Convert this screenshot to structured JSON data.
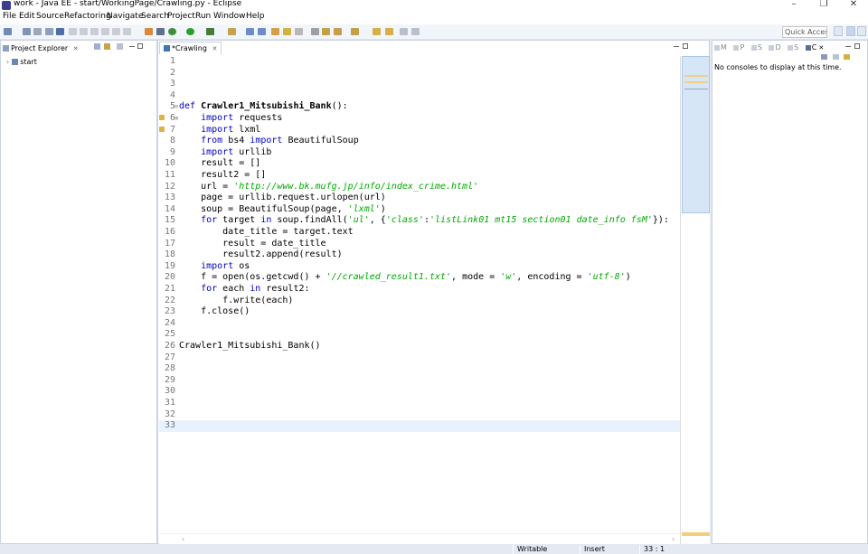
{
  "window": {
    "title": "work - Java EE - start/WorkingPage/Crawling.py - Eclipse",
    "minimize": "–",
    "restore": "❐",
    "close": "✕"
  },
  "menu": [
    "File",
    "Edit",
    "Source",
    "Refactoring",
    "Navigate",
    "Search",
    "Project",
    "Run",
    "Window",
    "Help"
  ],
  "toolbar": {
    "quick_access_placeholder": "Quick Access"
  },
  "project_explorer": {
    "title": "Project Explorer",
    "close": "✕",
    "tree": [
      {
        "label": "start",
        "expander": "›"
      }
    ]
  },
  "editor": {
    "tab_label": "*Crawling",
    "tab_close": "✕",
    "current_line": 33,
    "lines": [
      {
        "n": 1,
        "segs": []
      },
      {
        "n": 2,
        "segs": []
      },
      {
        "n": 3,
        "segs": []
      },
      {
        "n": 4,
        "segs": []
      },
      {
        "n": 5,
        "fold": "⊖",
        "segs": [
          {
            "t": "kw",
            "v": "def "
          },
          {
            "t": "fn",
            "v": "Crawler1_Mitsubishi_Bank"
          },
          {
            "t": "",
            "v": "():"
          }
        ]
      },
      {
        "n": 6,
        "fold": "⊕",
        "warn": true,
        "segs": [
          {
            "t": "",
            "v": "    "
          },
          {
            "t": "kw",
            "v": "import"
          },
          {
            "t": "",
            "v": " requests"
          }
        ]
      },
      {
        "n": 7,
        "warn": true,
        "segs": [
          {
            "t": "",
            "v": "    "
          },
          {
            "t": "kw",
            "v": "import"
          },
          {
            "t": "",
            "v": " lxml"
          }
        ]
      },
      {
        "n": 8,
        "segs": [
          {
            "t": "",
            "v": "    "
          },
          {
            "t": "kw",
            "v": "from"
          },
          {
            "t": "",
            "v": " bs4 "
          },
          {
            "t": "kw",
            "v": "import"
          },
          {
            "t": "",
            "v": " BeautifulSoup"
          }
        ]
      },
      {
        "n": 9,
        "segs": [
          {
            "t": "",
            "v": "    "
          },
          {
            "t": "kw",
            "v": "import"
          },
          {
            "t": "",
            "v": " urllib"
          }
        ]
      },
      {
        "n": 10,
        "segs": [
          {
            "t": "",
            "v": "    result = []"
          }
        ]
      },
      {
        "n": 11,
        "segs": [
          {
            "t": "",
            "v": "    result2 = []"
          }
        ]
      },
      {
        "n": 12,
        "segs": [
          {
            "t": "",
            "v": "    url = "
          },
          {
            "t": "str",
            "v": "'http://www.bk.mufg.jp/info/index_crime.html'"
          }
        ]
      },
      {
        "n": 13,
        "segs": [
          {
            "t": "",
            "v": "    page = urllib.request.urlopen(url)"
          }
        ]
      },
      {
        "n": 14,
        "segs": [
          {
            "t": "",
            "v": "    soup = BeautifulSoup(page, "
          },
          {
            "t": "str",
            "v": "'lxml'"
          },
          {
            "t": "",
            "v": ")"
          }
        ]
      },
      {
        "n": 15,
        "segs": [
          {
            "t": "",
            "v": "    "
          },
          {
            "t": "kw",
            "v": "for"
          },
          {
            "t": "",
            "v": " target "
          },
          {
            "t": "kw",
            "v": "in"
          },
          {
            "t": "",
            "v": " soup.findAll("
          },
          {
            "t": "str",
            "v": "'ul'"
          },
          {
            "t": "",
            "v": ", {"
          },
          {
            "t": "str",
            "v": "'class'"
          },
          {
            "t": "",
            "v": ":"
          },
          {
            "t": "str",
            "v": "'listLink01 mt15 section01 date_info fsM'"
          },
          {
            "t": "",
            "v": "}):"
          }
        ]
      },
      {
        "n": 16,
        "segs": [
          {
            "t": "",
            "v": "        date_title = target.text"
          }
        ]
      },
      {
        "n": 17,
        "segs": [
          {
            "t": "",
            "v": "        result = date_title"
          }
        ]
      },
      {
        "n": 18,
        "segs": [
          {
            "t": "",
            "v": "        result2.append(result)"
          }
        ]
      },
      {
        "n": 19,
        "segs": [
          {
            "t": "",
            "v": "    "
          },
          {
            "t": "kw",
            "v": "import"
          },
          {
            "t": "",
            "v": " os"
          }
        ]
      },
      {
        "n": 20,
        "segs": [
          {
            "t": "",
            "v": "    f = open(os.getcwd() + "
          },
          {
            "t": "str",
            "v": "'//crawled_result1.txt'"
          },
          {
            "t": "",
            "v": ", mode = "
          },
          {
            "t": "str",
            "v": "'w'"
          },
          {
            "t": "",
            "v": ", encoding = "
          },
          {
            "t": "str",
            "v": "'utf-8'"
          },
          {
            "t": "",
            "v": ")"
          }
        ]
      },
      {
        "n": 21,
        "segs": [
          {
            "t": "",
            "v": "    "
          },
          {
            "t": "kw",
            "v": "for"
          },
          {
            "t": "",
            "v": " each "
          },
          {
            "t": "kw",
            "v": "in"
          },
          {
            "t": "",
            "v": " result2:"
          }
        ]
      },
      {
        "n": 22,
        "segs": [
          {
            "t": "",
            "v": "        f.write(each)"
          }
        ]
      },
      {
        "n": 23,
        "segs": [
          {
            "t": "",
            "v": "    f.close()"
          }
        ]
      },
      {
        "n": 24,
        "segs": []
      },
      {
        "n": 25,
        "segs": []
      },
      {
        "n": 26,
        "segs": [
          {
            "t": "",
            "v": "Crawler1_Mitsubishi_Bank()"
          }
        ]
      },
      {
        "n": 27,
        "segs": []
      },
      {
        "n": 28,
        "segs": []
      },
      {
        "n": 29,
        "segs": []
      },
      {
        "n": 30,
        "segs": []
      },
      {
        "n": 31,
        "segs": []
      },
      {
        "n": 32,
        "segs": []
      },
      {
        "n": 33,
        "segs": []
      }
    ]
  },
  "right_panel": {
    "tabs": [
      "M",
      "P",
      "S",
      "D",
      "S",
      "C"
    ],
    "close": "✕",
    "empty_message": "No consoles to display at this time."
  },
  "status": {
    "writable": "Writable",
    "insert": "Insert",
    "position": "33 : 1"
  },
  "colors": {
    "keyword": "#0000c0",
    "string": "#00aa00",
    "current_line": "#e8f2fe",
    "workspace": "#e4e9f2"
  }
}
